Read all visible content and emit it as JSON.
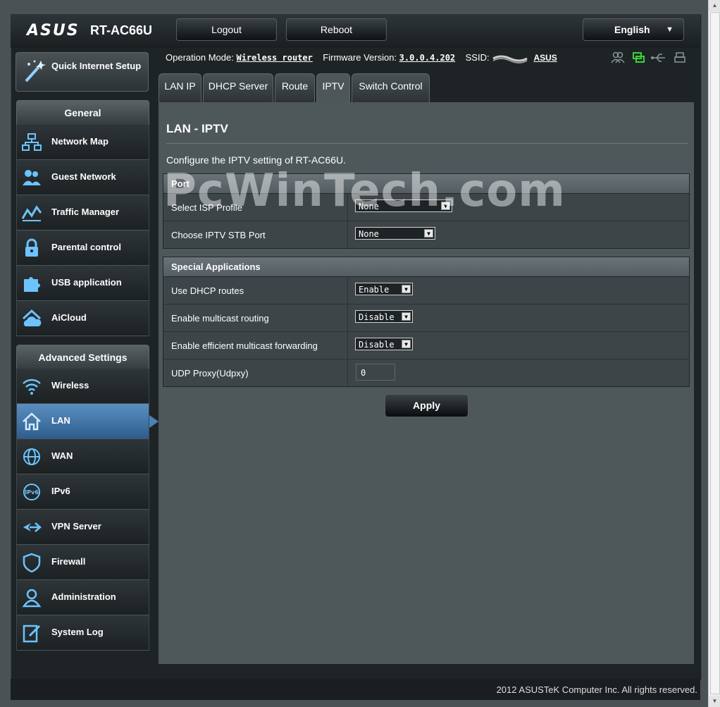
{
  "header": {
    "logo": "ASUS",
    "model": "RT-AC66U",
    "logout_label": "Logout",
    "reboot_label": "Reboot",
    "language": "English"
  },
  "quick_setup": {
    "label": "Quick Internet Setup"
  },
  "sidebar": {
    "general_title": "General",
    "general_items": [
      {
        "label": "Network Map",
        "icon": "network-map-icon"
      },
      {
        "label": "Guest Network",
        "icon": "guest-network-icon"
      },
      {
        "label": "Traffic Manager",
        "icon": "traffic-manager-icon"
      },
      {
        "label": "Parental control",
        "icon": "lock-icon"
      },
      {
        "label": "USB application",
        "icon": "puzzle-icon"
      },
      {
        "label": "AiCloud",
        "icon": "cloud-icon"
      }
    ],
    "advanced_title": "Advanced Settings",
    "advanced_items": [
      {
        "label": "Wireless",
        "icon": "wifi-icon"
      },
      {
        "label": "LAN",
        "icon": "home-icon",
        "active": true
      },
      {
        "label": "WAN",
        "icon": "globe-icon"
      },
      {
        "label": "IPv6",
        "icon": "ipv6-icon"
      },
      {
        "label": "VPN Server",
        "icon": "vpn-icon"
      },
      {
        "label": "Firewall",
        "icon": "shield-icon"
      },
      {
        "label": "Administration",
        "icon": "admin-icon"
      },
      {
        "label": "System Log",
        "icon": "log-icon"
      }
    ]
  },
  "status": {
    "op_mode_label": "Operation Mode:",
    "op_mode_value": "Wireless router",
    "fw_label": "Firmware Version:",
    "fw_value": "3.0.0.4.202",
    "ssid_label": "SSID:",
    "ssid_value": "ASUS"
  },
  "tabs": [
    {
      "label": "LAN IP"
    },
    {
      "label": "DHCP Server"
    },
    {
      "label": "Route"
    },
    {
      "label": "IPTV",
      "active": true
    },
    {
      "label": "Switch Control"
    }
  ],
  "page": {
    "title": "LAN - IPTV",
    "description": "Configure the IPTV setting of RT-AC66U.",
    "watermark": "PcWinTech.com"
  },
  "port_section": {
    "title": "Port",
    "rows": [
      {
        "label": "Select ISP Profile",
        "value": "None"
      },
      {
        "label": "Choose IPTV STB Port",
        "value": "None"
      }
    ]
  },
  "special_section": {
    "title": "Special Applications",
    "rows": [
      {
        "label": "Use DHCP routes",
        "value": "Enable"
      },
      {
        "label": "Enable multicast routing",
        "value": "Disable"
      },
      {
        "label": "Enable efficient multicast forwarding",
        "value": "Disable"
      },
      {
        "label": "UDP Proxy(Udpxy)",
        "value": "0"
      }
    ]
  },
  "apply_label": "Apply",
  "footer": "2012 ASUSTeK Computer Inc. All rights reserved."
}
